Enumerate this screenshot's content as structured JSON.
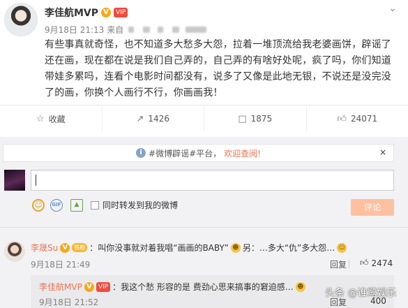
{
  "post": {
    "author": "李佳航MVP",
    "verified_badge": "V",
    "vip_badge": "VIP",
    "date": "9月18日 21:13 来自",
    "text": "有些事真就奇怪，也不知道多大愁多大怨，拉着一堆顶流给我老婆画饼，辟谣了还在画，现在都在说是我们自己弄的，自己弄的有啥好处呢，疯了吗，你们知道带娃多累吗，连看个电影时间都没有，说多了又像是此地无银，不说还是没完没了的画，你换个人画行不行，你画画我！",
    "chevron_icon": "chevron-down-icon"
  },
  "actions": [
    {
      "icon": "star-icon",
      "label": "收藏"
    },
    {
      "icon": "share-icon",
      "label": "1426"
    },
    {
      "icon": "comment-icon",
      "label": "1875"
    },
    {
      "icon": "thumbs-up-icon",
      "label": "24071"
    }
  ],
  "notice": {
    "prefix": "#微博辟谣#平台，",
    "link": "欢迎查阅!",
    "close": "×"
  },
  "compose": {
    "input_value": "",
    "repost_label": "同时转发到我的微博",
    "submit_label": "评论",
    "submit_color": "#ffc09f"
  },
  "comment": {
    "user": "李晟Su",
    "text": "：叫你没事就对着我唱“画画的BABY”",
    "text2": "另：…多大“仇”多大怨…",
    "time": "9月18日 21:49",
    "reply_label": "回复",
    "likes": "2474",
    "fan_badge": "铁粉"
  },
  "sub_reply": {
    "user": "李佳航MVP",
    "text": "：我这个愁 形容的是 费劲心思来搞事的窘迫感…",
    "time": "9月18日 21:52",
    "reply_label": "回复",
    "likes": "400"
  },
  "watermark": "头条 @谁鹭娱乐",
  "accent_color": "#eb7350"
}
